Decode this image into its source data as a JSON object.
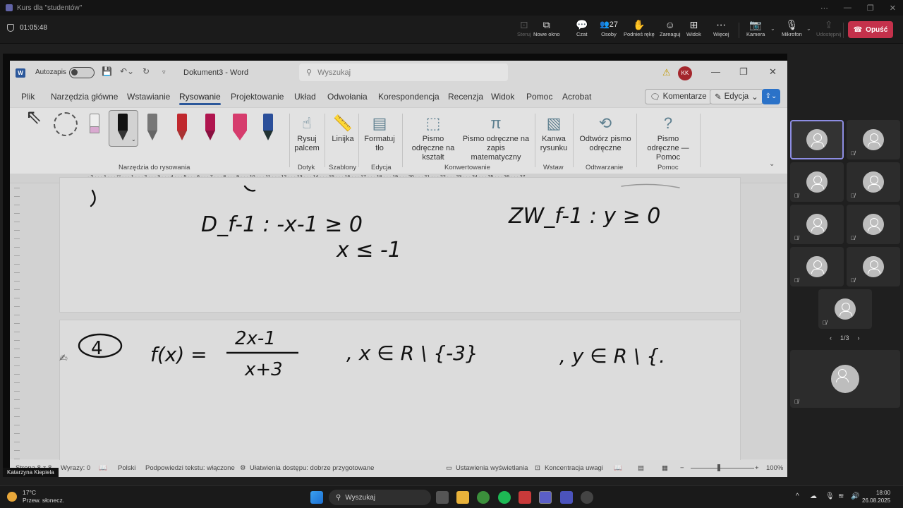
{
  "teams": {
    "window_title": "Kurs dla \"studentów\"",
    "timer": "01:05:48",
    "toolbar": [
      {
        "label": "Steruj",
        "icon": "control-icon",
        "glyph": "⊡",
        "disabled": true
      },
      {
        "label": "Nowe okno",
        "icon": "new-window-icon",
        "glyph": "⧉",
        "disabled": false
      },
      {
        "label": "Czat",
        "icon": "chat-icon",
        "glyph": "💬",
        "disabled": false
      },
      {
        "label": "Osoby",
        "icon": "people-icon",
        "glyph": "👥",
        "disabled": false,
        "count": "27"
      },
      {
        "label": "Podnieś rękę",
        "icon": "raise-hand-icon",
        "glyph": "✋",
        "disabled": false
      },
      {
        "label": "Zareaguj",
        "icon": "react-icon",
        "glyph": "☺",
        "disabled": false
      },
      {
        "label": "Widok",
        "icon": "view-icon",
        "glyph": "⊞",
        "disabled": false
      },
      {
        "label": "Więcej",
        "icon": "more-icon",
        "glyph": "⋯",
        "disabled": false
      },
      {
        "label": "Kamera",
        "icon": "camera-off-icon",
        "glyph": "📷",
        "disabled": false
      },
      {
        "label": "Mikrofon",
        "icon": "mic-off-icon",
        "glyph": "🎙",
        "disabled": false
      },
      {
        "label": "Udostępnij",
        "icon": "share-icon",
        "glyph": "⇪",
        "disabled": true
      }
    ],
    "leave_label": "Opuść",
    "presenter_name": "Katarzyna Kiepiela",
    "pager": "1/3"
  },
  "word": {
    "autosave_label": "Autozapis",
    "doc_title": "Dokument3  -  Word",
    "search_placeholder": "Wyszukaj",
    "user_initials": "KK",
    "tabs": [
      "Plik",
      "Narzędzia główne",
      "Wstawianie",
      "Rysowanie",
      "Projektowanie",
      "Układ",
      "Odwołania",
      "Korespondencja",
      "Recenzja",
      "Widok",
      "Pomoc",
      "Acrobat"
    ],
    "active_tab": "Rysowanie",
    "comments_label": "Komentarze",
    "edit_label": "Edycja",
    "ribbon": {
      "draw_tools_label": "Narzędzia do rysowania",
      "draw_with_touch": "Rysuj palcem",
      "touch_label": "Dotyk",
      "ruler": "Linijka",
      "stencils_label": "Szablony",
      "format_bg": "Formatuj tło",
      "edit_group": "Edycja",
      "ink_to_shape": "Pismo odręczne na kształt",
      "ink_to_math": "Pismo odręczne na zapis matematyczny",
      "convert_label": "Konwertowanie",
      "canvas": "Kanwa rysunku",
      "insert_label": "Wstaw",
      "replay": "Odtwórz pismo odręczne",
      "replay_label": "Odtwarzanie",
      "ink_help": "Pismo odręczne — Pomoc",
      "help_label": "Pomoc"
    },
    "ruler_numbers": "· 2 · · · 1 · · · ▽ · · · 1 · · · 2 · · · 3 · · · 4 · · · 5 · · · 6 · · · 7 · · · 8 · · · 9 · · · 10 · · · 11 · · · 12 · · · 13 · · · 14 · · · 15 · · · 16 · · · 17 · · · 18 · · · 19 · · · 20 · · · 21 · · · 22 · · · 23 · · · 24 · · · 25 · · · 26 · · · 27",
    "ink": {
      "line1": "D_f-1 :   -x-1 ≥ 0",
      "line2": "x ≤ -1",
      "line3": "ZW_f-1 :  y ≥ 0",
      "num": "4",
      "fx_left": "f(x) =",
      "numerator": "2x-1",
      "denominator": "x+3",
      "domain": ", x ∈ R \\ {-3}",
      "range": ", y ∈ R \\ {."
    },
    "status": {
      "page": "Strona 8 z 8",
      "words": "Wyrazy: 0",
      "lang": "Polski",
      "suggestions": "Podpowiedzi tekstu: włączone",
      "accessibility": "Ułatwienia dostępu: dobrze przygotowane",
      "display_settings": "Ustawienia wyświetlania",
      "focus": "Koncentracja uwagi",
      "zoom": "100%"
    }
  },
  "taskbar": {
    "temp": "17°C",
    "weather": "Przew. słonecz.",
    "search": "Wyszukaj",
    "time": "18:00",
    "date": "26.08.2025"
  }
}
